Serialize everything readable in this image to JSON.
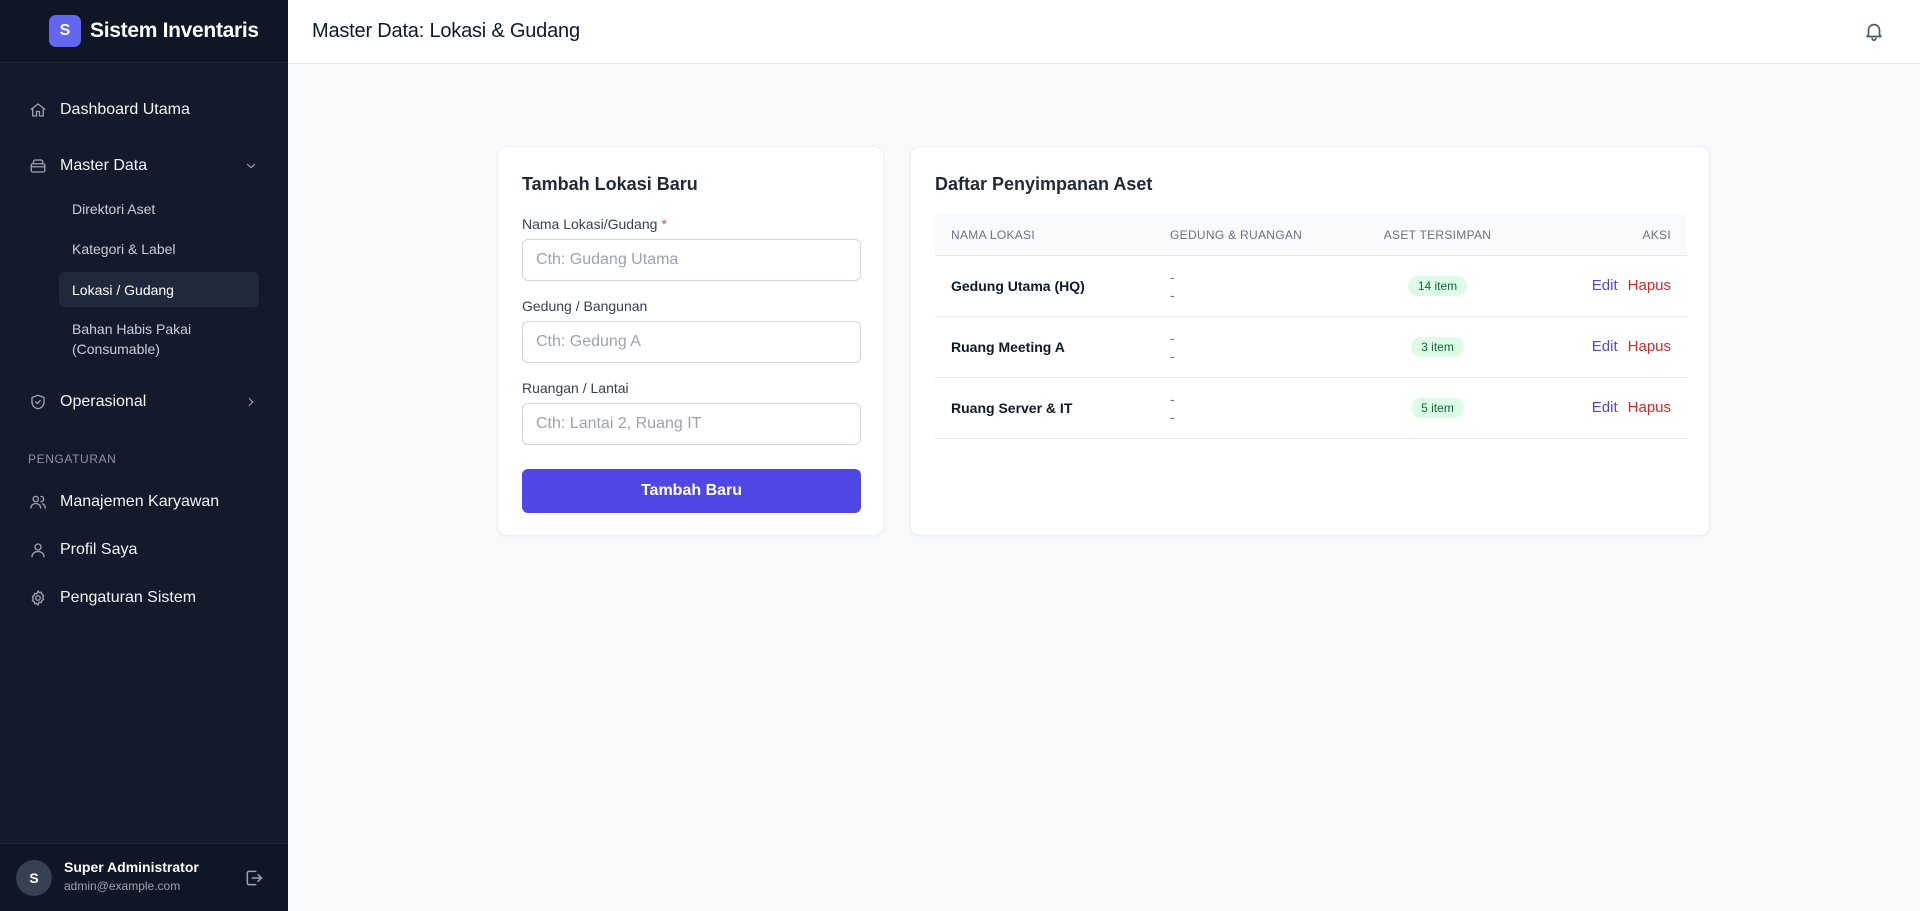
{
  "app": {
    "logo_letter": "S",
    "title": "Sistem Inventaris"
  },
  "sidebar": {
    "items": [
      {
        "label": "Dashboard Utama",
        "icon": "home-icon"
      },
      {
        "label": "Master Data",
        "icon": "archive-icon",
        "expanded": true
      },
      {
        "label": "Operasional",
        "icon": "shield-check-icon",
        "expanded": false
      }
    ],
    "master_sub": [
      {
        "label": "Direktori Aset",
        "active": false
      },
      {
        "label": "Kategori & Label",
        "active": false
      },
      {
        "label": "Lokasi / Gudang",
        "active": true
      },
      {
        "label": "Bahan Habis Pakai (Consumable)",
        "active": false
      }
    ],
    "section_label": "PENGATURAN",
    "settings_items": [
      {
        "label": "Manajemen Karyawan",
        "icon": "users-icon"
      },
      {
        "label": "Profil Saya",
        "icon": "user-icon"
      },
      {
        "label": "Pengaturan Sistem",
        "icon": "gear-icon"
      }
    ],
    "user": {
      "initial": "S",
      "name": "Super Administrator",
      "email": "admin@example.com"
    }
  },
  "header": {
    "title": "Master Data: Lokasi & Gudang"
  },
  "form": {
    "title": "Tambah Lokasi Baru",
    "name_label": "Nama Lokasi/Gudang",
    "required_mark": "*",
    "name_placeholder": "Cth: Gudang Utama",
    "building_label": "Gedung / Bangunan",
    "building_placeholder": "Cth: Gedung A",
    "room_label": "Ruangan / Lantai",
    "room_placeholder": "Cth: Lantai 2, Ruang IT",
    "submit_label": "Tambah Baru"
  },
  "list": {
    "title": "Daftar Penyimpanan Aset",
    "columns": [
      "NAMA LOKASI",
      "GEDUNG & RUANGAN",
      "ASET TERSIMPAN",
      "AKSI"
    ],
    "rows": [
      {
        "name": "Gedung Utama (HQ)",
        "building": "-",
        "room": "-",
        "count": "14 item"
      },
      {
        "name": "Ruang Meeting A",
        "building": "-",
        "room": "-",
        "count": "3 item"
      },
      {
        "name": "Ruang Server & IT",
        "building": "-",
        "room": "-",
        "count": "5 item"
      }
    ],
    "edit_label": "Edit",
    "delete_label": "Hapus"
  },
  "colors": {
    "accent": "#4f46e5",
    "sidebar_bg": "#121a2b",
    "danger": "#dc2626",
    "badge_bg": "#dcfce7"
  }
}
